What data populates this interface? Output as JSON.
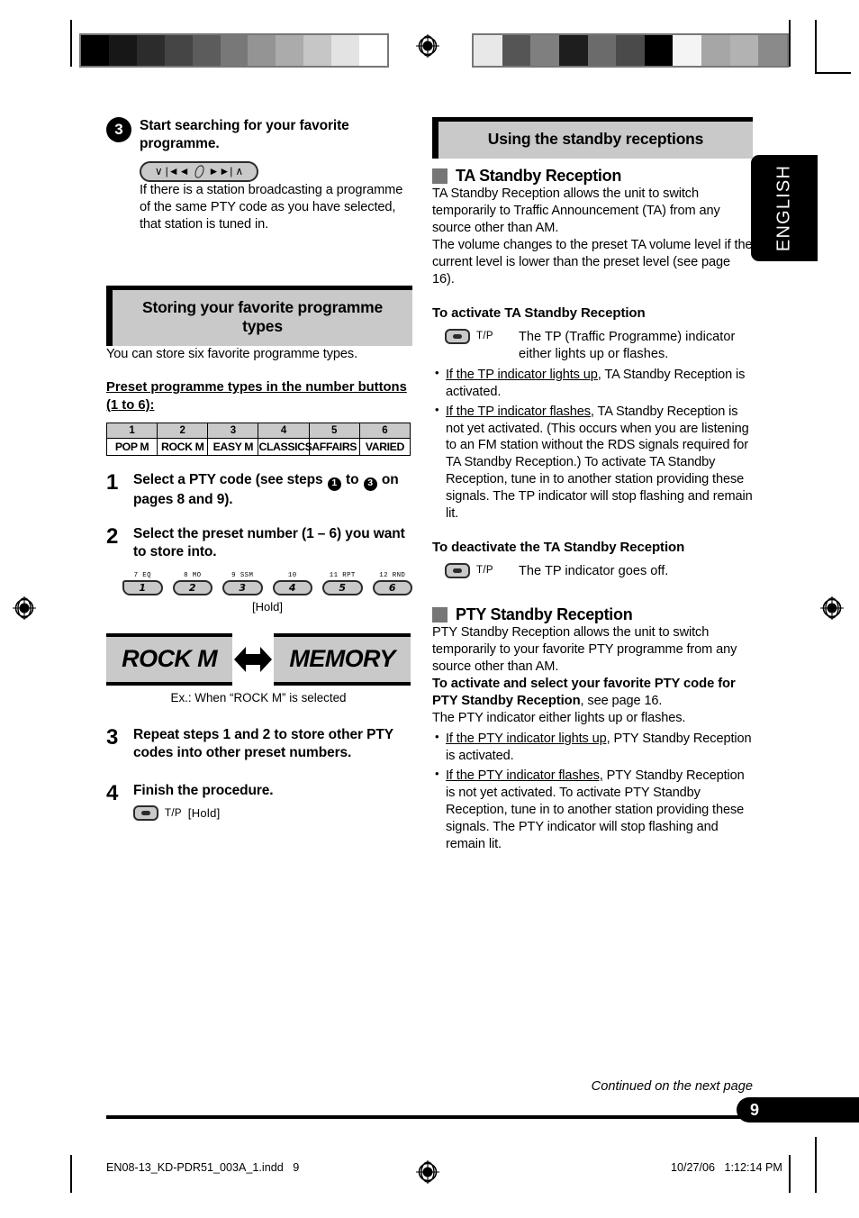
{
  "document": {
    "language_tab": "ENGLISH",
    "page_number": "9",
    "continued_note": "Continued on the next page",
    "footer_file": "EN08-13_KD-PDR51_003A_1.indd   9",
    "footer_timestamp": "10/27/06   1:12:14 PM"
  },
  "colors": {
    "banner_fill": "#c9c9c9",
    "square_bullet": "#767676",
    "button_fill": "#c9c9c9",
    "ink": "#000000"
  },
  "calibration_bars": {
    "left": [
      "#000000",
      "#171717",
      "#2c2c2c",
      "#454545",
      "#5c5c5c",
      "#787878",
      "#949494",
      "#ababab",
      "#c6c6c6",
      "#e3e3e3",
      "#ffffff"
    ],
    "right": [
      "#e8e8e8",
      "#555555",
      "#7f7f7f",
      "#1e1e1e",
      "#6b6b6b",
      "#4a4a4a",
      "#000000",
      "#f4f4f4",
      "#a6a6a6",
      "#b2b2b2",
      "#8a8a8a"
    ]
  },
  "left_column": {
    "step3_top": {
      "number": "3",
      "title": "Start searching for your favorite programme.",
      "control_glyphs": [
        "∨",
        "|◄◄",
        "/",
        "►►|",
        "∧"
      ],
      "body": "If there is a station broadcasting a programme of the same PTY code as you have selected, that station is tuned in."
    },
    "banner": "Storing your favorite programme types",
    "intro": "You can store six favorite programme types.",
    "preset_heading": "Preset programme types in the number buttons (1 to 6):",
    "preset_table": {
      "numbers": [
        "1",
        "2",
        "3",
        "4",
        "5",
        "6"
      ],
      "types": [
        "POP M",
        "ROCK M",
        "EASY M",
        "CLASSICS",
        "AFFAIRS",
        "VARIED"
      ]
    },
    "step1": {
      "number": "1",
      "title_a": "Select a PTY code (see steps ",
      "circ_a": "1",
      "title_b": " to ",
      "circ_b": "3",
      "title_c": " on pages 8 and 9)."
    },
    "step2": {
      "number": "2",
      "title": "Select the preset number (1 – 6) you want to store into.",
      "buttons": [
        {
          "cap": "7  EQ",
          "label": "1"
        },
        {
          "cap": "8  MO",
          "label": "2"
        },
        {
          "cap": "9  SSM",
          "label": "3"
        },
        {
          "cap": "10",
          "label": "4"
        },
        {
          "cap": "11  RPT",
          "label": "5"
        },
        {
          "cap": "12  RND",
          "label": "6"
        }
      ],
      "hold": "[Hold]"
    },
    "display_example": {
      "left_text": "ROCK M",
      "right_text": "MEMORY",
      "caption": "Ex.: When “ROCK M” is selected"
    },
    "step3": {
      "number": "3",
      "title": "Repeat steps 1 and 2 to store other PTY codes into other preset numbers."
    },
    "step4": {
      "number": "4",
      "title": "Finish the procedure.",
      "button_label": "T/P",
      "hold": "[Hold]"
    }
  },
  "right_column": {
    "banner": "Using the standby receptions",
    "ta": {
      "heading": "TA Standby Reception",
      "para1": "TA Standby Reception allows the unit to switch temporarily to Traffic Announcement (TA) from any source other than AM.",
      "para2": "The volume changes to the preset TA volume level if the current level is lower than the preset level (see page 16).",
      "activate_heading": "To activate TA Standby Reception",
      "activate_button_label": "T/P",
      "activate_button_text": "The TP (Traffic Programme) indicator either lights up or flashes.",
      "bullets": [
        {
          "underline": "If the TP indicator lights up,",
          "rest": " TA Standby Reception is activated."
        },
        {
          "underline": "If the TP indicator flashes,",
          "rest": " TA Standby Reception is not yet activated. (This occurs when you are listening to an FM station without the RDS signals required for TA Standby Reception.) To activate TA Standby Reception, tune in to another station providing these signals. The TP indicator will stop flashing and remain lit."
        }
      ],
      "deactivate_heading": "To deactivate the TA Standby Reception",
      "deactivate_button_label": "T/P",
      "deactivate_button_text": "The TP indicator goes off."
    },
    "pty": {
      "heading": "PTY Standby Reception",
      "para1": "PTY Standby Reception allows the unit to switch temporarily to your favorite PTY programme from any source other than AM.",
      "activate_bold": "To activate and select your favorite PTY code for PTY Standby Reception",
      "activate_rest": ", see page 16.",
      "para2": "The PTY indicator either lights up or flashes.",
      "bullets": [
        {
          "underline": "If the PTY indicator lights up,",
          "rest": " PTY Standby Reception is activated."
        },
        {
          "underline": "If the PTY indicator flashes,",
          "rest": " PTY Standby Reception is not yet activated. To activate PTY Standby Reception, tune in to another station providing these signals. The PTY indicator will stop flashing and remain lit."
        }
      ]
    }
  }
}
